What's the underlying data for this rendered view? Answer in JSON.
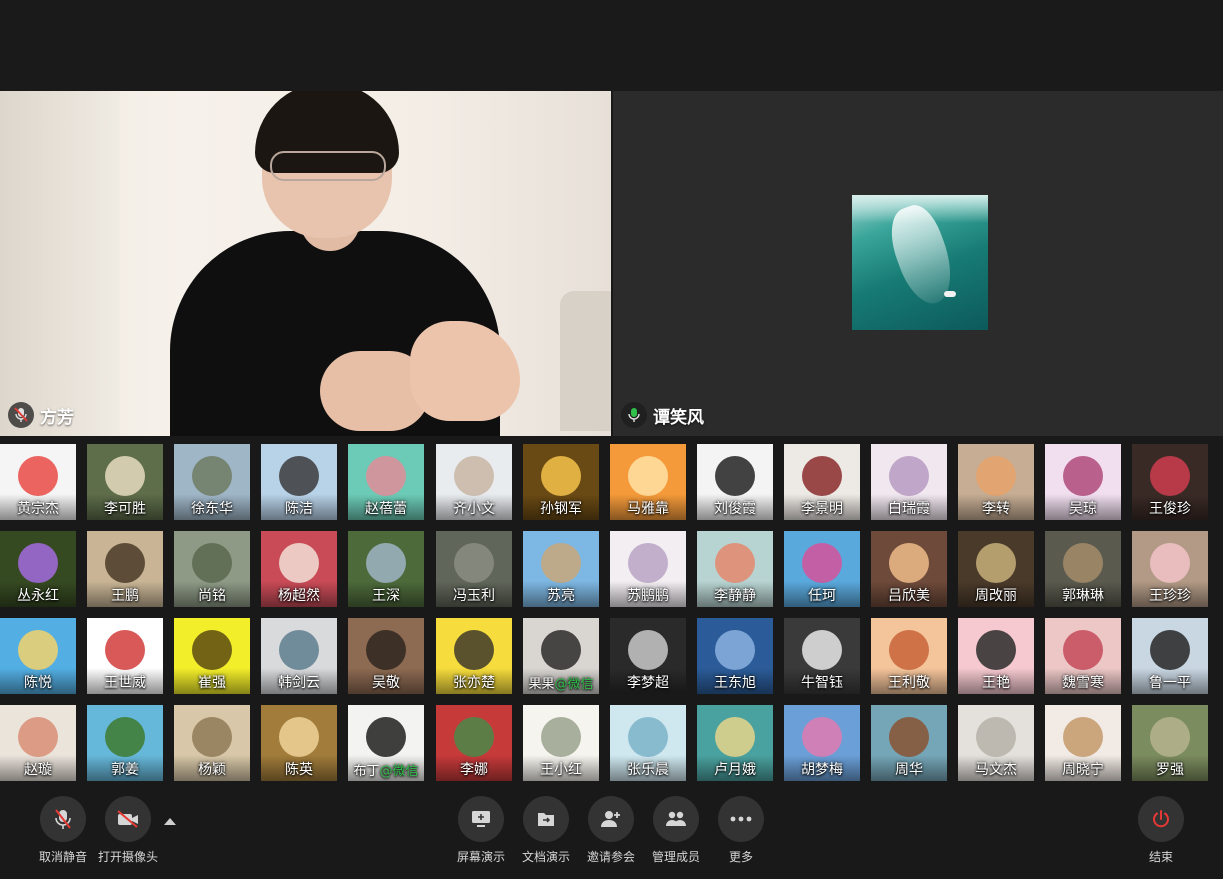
{
  "videos": {
    "left": {
      "name": "方芳"
    },
    "right": {
      "name": "谭笑风"
    }
  },
  "participants": [
    {
      "name": "黄宗杰",
      "bg": "#f5f5f5",
      "fg": "#e94a44"
    },
    {
      "name": "李可胜",
      "bg": "#5e6d4a",
      "fg": "#e8dcc0"
    },
    {
      "name": "徐东华",
      "bg": "#9fb6c7",
      "fg": "#6f7b63"
    },
    {
      "name": "陈洁",
      "bg": "#b8d2e8",
      "fg": "#3b3b3b"
    },
    {
      "name": "赵蓓蕾",
      "bg": "#6ccbb6",
      "fg": "#e08d9a"
    },
    {
      "name": "齐小文",
      "bg": "#e9ecef",
      "fg": "#c8b6a4"
    },
    {
      "name": "孙钢军",
      "bg": "#6a4a14",
      "fg": "#f4c24a"
    },
    {
      "name": "马雅靠",
      "bg": "#f59a3a",
      "fg": "#ffe2a6"
    },
    {
      "name": "刘俊霞",
      "bg": "#f4f4f4",
      "fg": "#222222"
    },
    {
      "name": "李景明",
      "bg": "#ede9e4",
      "fg": "#8a2c2c"
    },
    {
      "name": "白瑞霞",
      "bg": "#f1e7ef",
      "fg": "#b79ac2"
    },
    {
      "name": "李转",
      "bg": "#c6ad94",
      "fg": "#e6a26a"
    },
    {
      "name": "吴琼",
      "bg": "#f1dff0",
      "fg": "#b04a7a"
    },
    {
      "name": "王俊珍",
      "bg": "#3a2a26",
      "fg": "#cf3d50"
    },
    {
      "name": "丛永红",
      "bg": "#364a22",
      "fg": "#a46be0"
    },
    {
      "name": "王鹏",
      "bg": "#c9b596",
      "fg": "#4a3b28"
    },
    {
      "name": "尚铭",
      "bg": "#8e9a86",
      "fg": "#5b6850"
    },
    {
      "name": "杨超然",
      "bg": "#c94b57",
      "fg": "#f2e0d6"
    },
    {
      "name": "王深",
      "bg": "#4d6a3b",
      "fg": "#9fb4c6"
    },
    {
      "name": "冯玉利",
      "bg": "#606659",
      "fg": "#8b8d82"
    },
    {
      "name": "苏亮",
      "bg": "#7db7e3",
      "fg": "#c8a87a"
    },
    {
      "name": "苏鹏鹏",
      "bg": "#f2eef2",
      "fg": "#b9a3c4"
    },
    {
      "name": "李静静",
      "bg": "#b8d4d2",
      "fg": "#e4876d"
    },
    {
      "name": "任珂",
      "bg": "#5aa9dd",
      "fg": "#d6539b"
    },
    {
      "name": "吕欣美",
      "bg": "#6e4a3a",
      "fg": "#f0bc8a"
    },
    {
      "name": "周改丽",
      "bg": "#4a3a2a",
      "fg": "#c8b07a"
    },
    {
      "name": "郭琳琳",
      "bg": "#5a5a4e",
      "fg": "#a58c6a"
    },
    {
      "name": "王珍珍",
      "bg": "#b29a86",
      "fg": "#f2c3c8"
    },
    {
      "name": "陈悦",
      "bg": "#53aee3",
      "fg": "#f2d26b"
    },
    {
      "name": "王世威",
      "bg": "#ffffff",
      "fg": "#d23b3b"
    },
    {
      "name": "崔强",
      "bg": "#f3ee2a",
      "fg": "#5a4a12"
    },
    {
      "name": "韩剑云",
      "bg": "#d8dadc",
      "fg": "#5e7d8e"
    },
    {
      "name": "吴敬",
      "bg": "#8d6a52",
      "fg": "#2e2620"
    },
    {
      "name": "张亦楚",
      "bg": "#f6dc3c",
      "fg": "#3e3a2a"
    },
    {
      "name": "果果",
      "extra": "@微信",
      "bg": "#d9d6d2",
      "fg": "#2b2b2b"
    },
    {
      "name": "李梦超",
      "bg": "#2a2a2a",
      "fg": "#c9c9c9"
    },
    {
      "name": "王东旭",
      "bg": "#2b5c99",
      "fg": "#8bb2df"
    },
    {
      "name": "牛智钰",
      "bg": "#3a3a3a",
      "fg": "#e9e9e9"
    },
    {
      "name": "王利敬",
      "bg": "#f4c49a",
      "fg": "#c8643a"
    },
    {
      "name": "王艳",
      "bg": "#f6c9d0",
      "fg": "#2b2b2b"
    },
    {
      "name": "魏雪寒",
      "bg": "#ecc7c6",
      "fg": "#c64a5a"
    },
    {
      "name": "鲁一平",
      "bg": "#c9d7e3",
      "fg": "#262626"
    },
    {
      "name": "赵璇",
      "bg": "#ebe4db",
      "fg": "#d98e74"
    },
    {
      "name": "郭姜",
      "bg": "#66b8da",
      "fg": "#3e7a2e"
    },
    {
      "name": "杨颖",
      "bg": "#d8c7a8",
      "fg": "#8f7a56"
    },
    {
      "name": "陈英",
      "bg": "#a17c3a",
      "fg": "#f0d49a"
    },
    {
      "name": "布丁",
      "extra": "@微信",
      "bg": "#f3f3f1",
      "fg": "#1e1e1e"
    },
    {
      "name": "李娜",
      "bg": "#c73a3a",
      "fg": "#4a8a4a"
    },
    {
      "name": "王小红",
      "bg": "#f6f4ee",
      "fg": "#9aa38e"
    },
    {
      "name": "张乐晨",
      "bg": "#cfe8f0",
      "fg": "#7cb3c8"
    },
    {
      "name": "卢月娥",
      "bg": "#4aa2a0",
      "fg": "#e6d58a"
    },
    {
      "name": "胡梦梅",
      "bg": "#6a9fd8",
      "fg": "#e17ab0"
    },
    {
      "name": "周华",
      "bg": "#75a6b8",
      "fg": "#8a5232"
    },
    {
      "name": "马文杰",
      "bg": "#e4e1dc",
      "fg": "#b6b1a8"
    },
    {
      "name": "周晓宁",
      "bg": "#f2ebe5",
      "fg": "#c49a6b"
    },
    {
      "name": "罗强",
      "bg": "#7b8c5e",
      "fg": "#b6b48e"
    }
  ],
  "toolbar": {
    "unmute": "取消静音",
    "camera": "打开摄像头",
    "screen_share": "屏幕演示",
    "doc_share": "文档演示",
    "invite": "邀请参会",
    "manage": "管理成员",
    "more": "更多",
    "end": "结束"
  },
  "colors": {
    "accent_red": "#e53935",
    "green_extra": "#2fbf4a"
  }
}
